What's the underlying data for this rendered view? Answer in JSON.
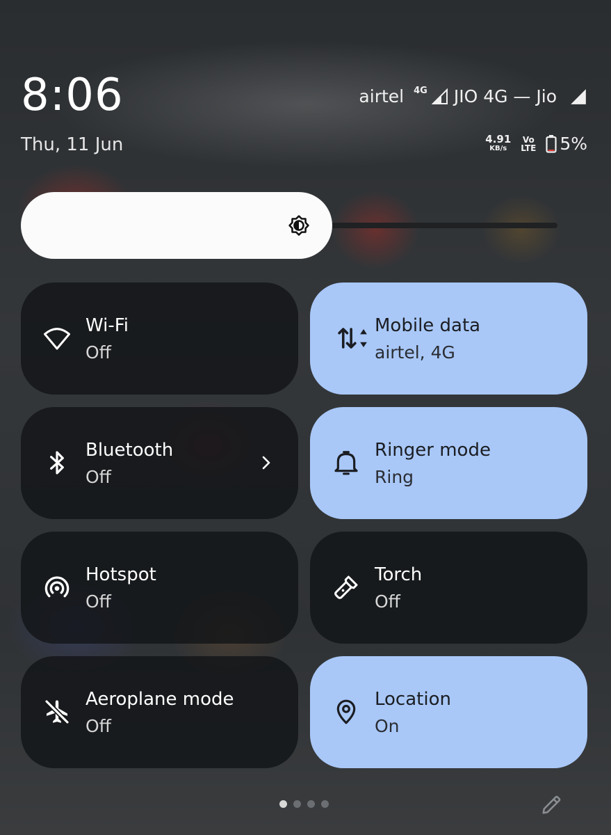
{
  "status": {
    "time": "8:06",
    "date": "Thu, 11 Jun",
    "carrier1": "airtel",
    "carrier1_net": "4G",
    "carrier2": "JIO 4G — Jio",
    "speed_value": "4.91",
    "speed_unit": "KB/s",
    "volte_top": "Vo",
    "volte_bottom": "LTE",
    "battery": "5%"
  },
  "brightness": {
    "level": 0.52
  },
  "tiles": [
    {
      "label": "Wi-Fi",
      "sub": "Off",
      "state": "off",
      "icon": "wifi-icon"
    },
    {
      "label": "Mobile data",
      "sub": "airtel, 4G",
      "state": "on",
      "icon": "mobile-data-icon"
    },
    {
      "label": "Bluetooth",
      "sub": "Off",
      "state": "off",
      "icon": "bluetooth-icon"
    },
    {
      "label": "Ringer mode",
      "sub": "Ring",
      "state": "on",
      "icon": "bell-icon"
    },
    {
      "label": "Hotspot",
      "sub": "Off",
      "state": "off",
      "icon": "hotspot-icon"
    },
    {
      "label": "Torch",
      "sub": "Off",
      "state": "off",
      "icon": "torch-icon"
    },
    {
      "label": "Aeroplane mode",
      "sub": "Off",
      "state": "off",
      "icon": "airplane-off-icon"
    },
    {
      "label": "Location",
      "sub": "On",
      "state": "on",
      "icon": "location-pin-icon"
    }
  ],
  "pager": {
    "pages": 4,
    "current": 1
  },
  "colors": {
    "tile_on": "#a9c8f8",
    "tile_off": "#141618",
    "slider_fill": "#fbfbfb"
  }
}
